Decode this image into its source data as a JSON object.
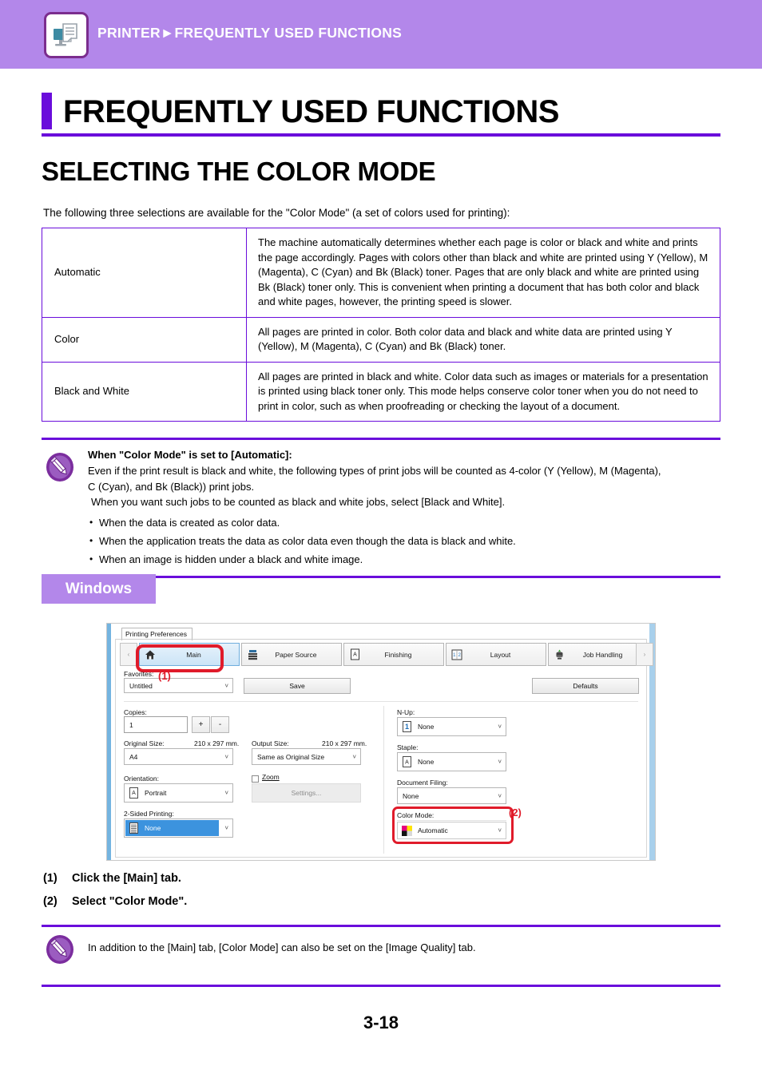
{
  "header": {
    "breadcrumb": "PRINTER►FREQUENTLY USED FUNCTIONS",
    "icon": "printer-document-icon",
    "bar_color": "#b387ea"
  },
  "headings": {
    "h1": "FREQUENTLY USED FUNCTIONS",
    "h2": "SELECTING THE COLOR MODE",
    "accent_color": "#6a0ddb"
  },
  "intro": "The following three selections are available for the \"Color Mode\" (a set of colors used for printing):",
  "mode_table": {
    "rows": [
      {
        "name": "Automatic",
        "description": "The machine automatically determines whether each page is color or black and white and prints the page accordingly. Pages with colors other than black and white are printed using Y (Yellow), M (Magenta), C (Cyan) and Bk (Black) toner. Pages that are only black and white are printed using Bk (Black) toner only. This is convenient when printing a document that has both color and black and white pages, however, the printing speed is slower."
      },
      {
        "name": "Color",
        "description": "All pages are printed in color. Both color data and black and white data are printed using Y (Yellow), M (Magenta), C (Cyan) and Bk (Black) toner."
      },
      {
        "name": "Black and White",
        "description": "All pages are printed in black and white. Color data such as images or materials for a presentation is printed using black toner only. This mode helps conserve color toner when you do not need to print in color, such as when proofreading or checking the layout of a document."
      }
    ]
  },
  "note_main": {
    "icon": "pencil-note-icon",
    "title": "When \"Color Mode\" is set to [Automatic]:",
    "line1": "Even if the print result is black and white, the following types of print jobs will be counted as 4-color (Y (Yellow), M (Magenta),",
    "line2": "C (Cyan), and Bk (Black)) print jobs.",
    "line3": "When you want such jobs to be counted as black and white jobs, select [Black and White].",
    "bullets": [
      "When the data is created as color data.",
      "When the application treats the data as color data even though the data is black and white.",
      "When an image is hidden under a black and white image."
    ]
  },
  "platform_badge": "Windows",
  "dialog": {
    "window_tab": "Printing Preferences",
    "tabs": [
      {
        "label": "Main",
        "icon": "home-icon",
        "selected": true
      },
      {
        "label": "Paper Source",
        "icon": "paper-tray-icon",
        "selected": false
      },
      {
        "label": "Finishing",
        "icon": "page-a-icon",
        "selected": false
      },
      {
        "label": "Layout",
        "icon": "layout-12-icon",
        "selected": false
      },
      {
        "label": "Job Handling",
        "icon": "job-stack-icon",
        "selected": false
      }
    ],
    "scroll_left": "‹",
    "scroll_right": "›",
    "favorites": {
      "label": "Favorites:",
      "value": "Untitled",
      "save_button": "Save",
      "defaults_button": "Defaults"
    },
    "left_column": {
      "copies_label": "Copies:",
      "copies_value": "1",
      "plus_button": "+",
      "minus_button": "-",
      "original_size_label": "Original Size:",
      "original_size_dim": "210 x 297 mm.",
      "original_size_value": "A4",
      "output_size_label": "Output Size:",
      "output_size_dim": "210 x 297 mm.",
      "output_size_value": "Same as Original Size",
      "orientation_label": "Orientation:",
      "orientation_value": "Portrait",
      "orientation_icon": "portrait-a-icon",
      "zoom_label": "Zoom",
      "zoom_checked": false,
      "settings_button": "Settings...",
      "two_sided_label": "2-Sided Printing:",
      "two_sided_value": "None",
      "two_sided_icon": "sheet-lines-icon"
    },
    "right_column": {
      "nup_label": "N-Up:",
      "nup_value": "None",
      "nup_icon": "number-1-icon",
      "staple_label": "Staple:",
      "staple_value": "None",
      "staple_icon": "page-a-icon",
      "docfiling_label": "Document Filing:",
      "docfiling_value": "None",
      "colormode_label": "Color Mode:",
      "colormode_value": "Automatic",
      "colormode_icon": "cmyk-swatch-icon"
    },
    "callouts": {
      "one": "(1)",
      "two": "(2)"
    }
  },
  "steps": [
    {
      "num": "(1)",
      "text": "Click the [Main] tab."
    },
    {
      "num": "(2)",
      "text": "Select \"Color Mode\"."
    }
  ],
  "note_bottom": {
    "icon": "pencil-note-icon",
    "text": "In addition to the [Main] tab, [Color Mode] can also be set on the [Image Quality] tab."
  },
  "page_number": "3-18"
}
